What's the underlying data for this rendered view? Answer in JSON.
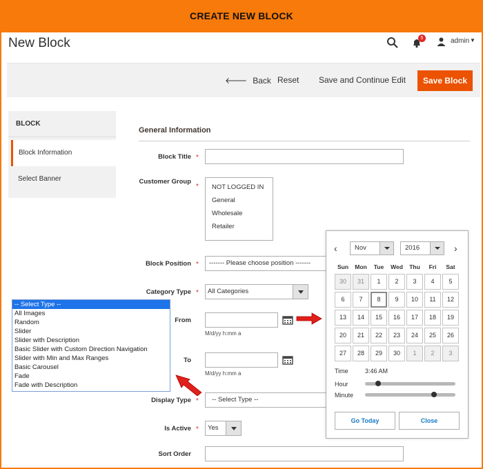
{
  "banner": {
    "title": "CREATE NEW BLOCK"
  },
  "header": {
    "page_title": "New Block",
    "notification_count": "5",
    "user": "admin"
  },
  "actions": {
    "back": "Back",
    "reset": "Reset",
    "save_continue": "Save and Continue Edit",
    "save": "Save Block"
  },
  "sidebar": {
    "heading": "BLOCK",
    "items": [
      {
        "label": "Block Information"
      },
      {
        "label": "Select Banner"
      }
    ]
  },
  "form": {
    "section_title": "General Information",
    "block_title": {
      "label": "Block Title",
      "value": ""
    },
    "customer_group": {
      "label": "Customer Group",
      "options": [
        "NOT LOGGED IN",
        "General",
        "Wholesale",
        "Retailer"
      ]
    },
    "block_position": {
      "label": "Block Position",
      "value": "------- Please choose position -------"
    },
    "category_type": {
      "label": "Category Type",
      "value": "All Categories"
    },
    "from": {
      "label": "From",
      "value": "",
      "note": "M/d/yy h:mm a"
    },
    "to": {
      "label": "To",
      "value": "",
      "note": "M/d/yy h:mm a"
    },
    "display_type": {
      "label": "Display Type",
      "value": "-- Select Type --"
    },
    "is_active": {
      "label": "Is Active",
      "value": "Yes"
    },
    "sort_order": {
      "label": "Sort Order",
      "value": ""
    }
  },
  "type_list": {
    "options": [
      "-- Select Type --",
      "All Images",
      "Random",
      "Slider",
      "Slider with Description",
      "Basic Slider with Custom Direction Navigation",
      "Slider with Min and Max Ranges",
      "Basic Carousel",
      "Fade",
      "Fade with Description"
    ],
    "highlighted": 0
  },
  "datepicker": {
    "prev": "‹",
    "next": "›",
    "month": "Nov",
    "year": "2016",
    "weekdays": [
      "Sun",
      "Mon",
      "Tue",
      "Wed",
      "Thu",
      "Fri",
      "Sat"
    ],
    "weeks": [
      [
        "30",
        "31",
        "1",
        "2",
        "3",
        "4",
        "5"
      ],
      [
        "6",
        "7",
        "8",
        "9",
        "10",
        "11",
        "12"
      ],
      [
        "13",
        "14",
        "15",
        "16",
        "17",
        "18",
        "19"
      ],
      [
        "20",
        "21",
        "22",
        "23",
        "24",
        "25",
        "26"
      ],
      [
        "27",
        "28",
        "29",
        "30",
        "1",
        "2",
        "3"
      ]
    ],
    "today": "8",
    "time_label": "Time",
    "time_value": "3:46 AM",
    "hour_label": "Hour",
    "minute_label": "Minute",
    "hour_level": 0.12,
    "minute_level": 0.78,
    "go_today": "Go Today",
    "close": "Close"
  },
  "colors": {
    "brand_orange": "#f77a0a",
    "save_button": "#eb5202",
    "link_blue": "#1979c3",
    "arrow_red": "#e0201a"
  }
}
